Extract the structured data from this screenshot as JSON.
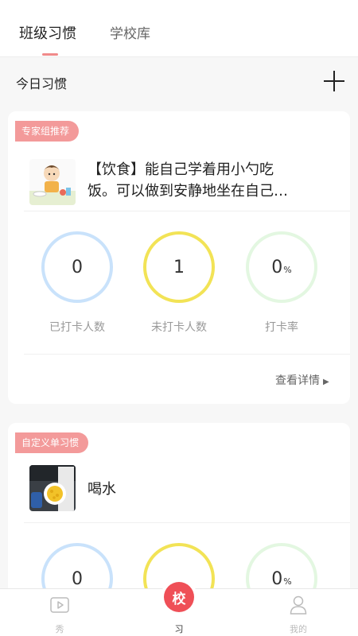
{
  "tabs": [
    {
      "label": "班级习惯",
      "active": true
    },
    {
      "label": "学校库",
      "active": false
    }
  ],
  "today": {
    "title": "今日习惯"
  },
  "cards": [
    {
      "tag": "专家组推荐",
      "habit_line1": "【饮食】能自己学着用小勺吃",
      "habit_line2": "饭。可以做到安静地坐在自己…",
      "stats": [
        {
          "value": "0",
          "label": "已打卡人数",
          "color": "#c9e2fb"
        },
        {
          "value": "1",
          "label": "未打卡人数",
          "color": "#f2e356"
        },
        {
          "value": "0",
          "unit": "%",
          "label": "打卡率",
          "color": "#e3f7e1"
        }
      ],
      "details_label": "查看详情"
    },
    {
      "tag": "自定义单习惯",
      "habit_line1": "喝水",
      "stats": [
        {
          "value": "0",
          "color": "#c9e2fb"
        },
        {
          "value": "",
          "color": "#f2e356"
        },
        {
          "value": "0",
          "unit": "%",
          "color": "#e3f7e1"
        }
      ]
    }
  ],
  "nav": {
    "items": [
      {
        "label": "秀",
        "icon": "video-play-icon"
      },
      {
        "label": "习",
        "icon": "school-icon"
      },
      {
        "label": "我的",
        "icon": "user-icon"
      }
    ],
    "center_badge": "校"
  },
  "colors": {
    "accent": "#ef4f57",
    "tag": "#f39a9a"
  }
}
